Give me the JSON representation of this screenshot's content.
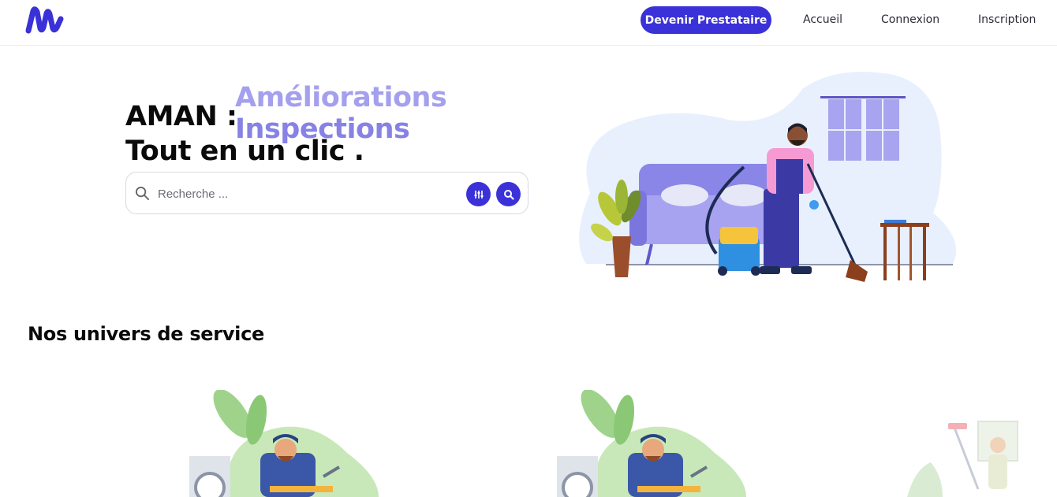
{
  "navbar": {
    "logo_alt": "AMAN",
    "cta_label": "Devenir Prestataire",
    "links": [
      "Accueil",
      "Connexion",
      "Inscription"
    ]
  },
  "hero": {
    "title_prefix": "AMAN :",
    "title_suffix": "Tout en un clic .",
    "rotating_words": [
      "Améliorations",
      "Inspections"
    ]
  },
  "search": {
    "placeholder": "Recherche ..."
  },
  "services": {
    "title": "Nos univers de service"
  },
  "colors": {
    "accent": "#3a31d8",
    "rotator_light": "#a4a0ee",
    "rotator_medium": "#8782e4"
  },
  "icons": {
    "search_field": "search-icon",
    "filter": "filter-icon",
    "search_submit": "search-icon"
  }
}
